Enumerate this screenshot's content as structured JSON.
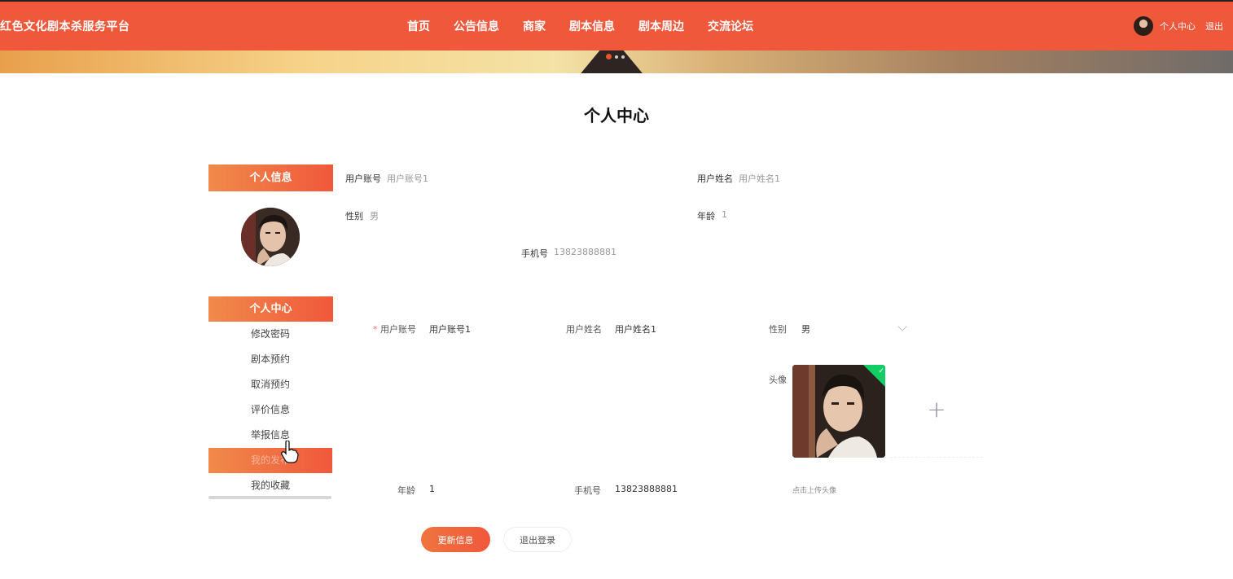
{
  "app": {
    "brand": "红色文化剧本杀服务平台"
  },
  "nav": {
    "items": [
      {
        "label": "首页"
      },
      {
        "label": "公告信息"
      },
      {
        "label": "商家"
      },
      {
        "label": "剧本信息"
      },
      {
        "label": "剧本周边"
      },
      {
        "label": "交流论坛"
      }
    ]
  },
  "user": {
    "center_label": "个人中心",
    "logout_label": "退出"
  },
  "page": {
    "title": "个人中心"
  },
  "sidebar": {
    "info_heading": "个人信息",
    "center_heading": "个人中心",
    "menu": [
      {
        "label": "修改密码"
      },
      {
        "label": "剧本预约"
      },
      {
        "label": "取消预约"
      },
      {
        "label": "评价信息"
      },
      {
        "label": "举报信息"
      },
      {
        "label": "我的发布",
        "active": true
      },
      {
        "label": "我的收藏"
      }
    ]
  },
  "info": {
    "account_label": "用户账号",
    "account_value": "用户账号1",
    "name_label": "用户姓名",
    "name_value": "用户姓名1",
    "gender_label": "性别",
    "gender_value": "男",
    "age_label": "年龄",
    "age_value": "1",
    "phone_label": "手机号",
    "phone_value": "13823888881"
  },
  "form": {
    "required_mark": "*",
    "account_label": "用户账号",
    "account_value": "用户账号1",
    "name_label": "用户姓名",
    "name_value": "用户姓名1",
    "gender_label": "性别",
    "gender_value": "男",
    "avatar_label": "头像",
    "upload_hint": "点击上传头像",
    "age_label": "年龄",
    "age_value": "1",
    "phone_label": "手机号",
    "phone_value": "13823888881"
  },
  "buttons": {
    "update": "更新信息",
    "logout": "退出登录"
  },
  "colors": {
    "primary": "#f0583b",
    "accent": "#f08a4b",
    "success": "#13ce66"
  },
  "icons": [
    "check-icon",
    "plus-icon",
    "chevron-down-icon",
    "hand-cursor-icon"
  ]
}
